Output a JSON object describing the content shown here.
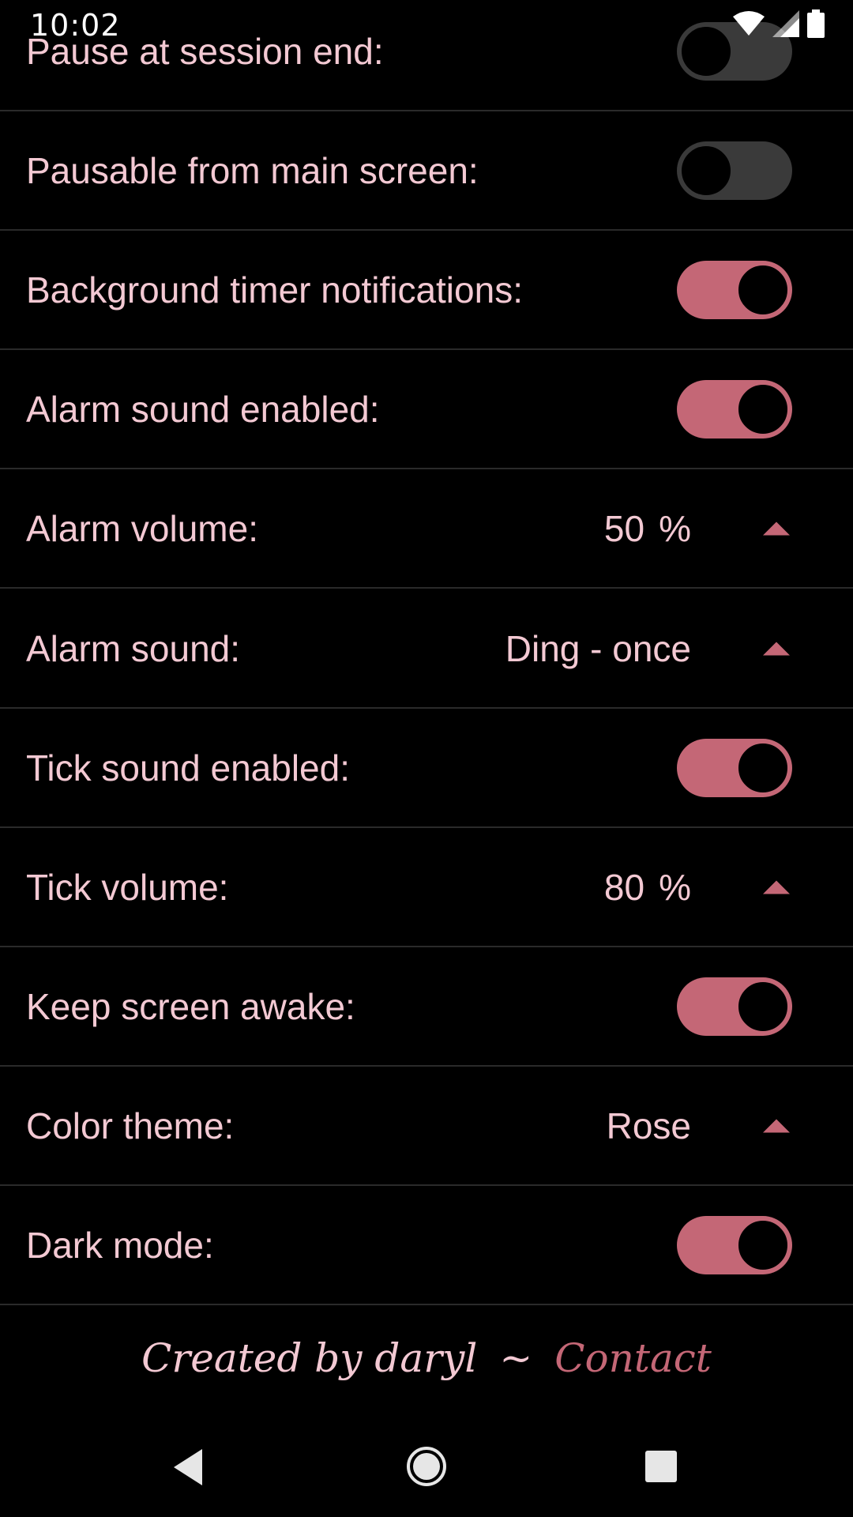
{
  "status_bar": {
    "time": "10:02",
    "icons": [
      "wifi-icon",
      "signal-icon",
      "battery-icon"
    ]
  },
  "settings": [
    {
      "label": "Pause at session end:",
      "type": "toggle",
      "on": false
    },
    {
      "label": "Pausable from main screen:",
      "type": "toggle",
      "on": false
    },
    {
      "label": "Background timer notifications:",
      "type": "toggle",
      "on": true
    },
    {
      "label": "Alarm sound enabled:",
      "type": "toggle",
      "on": true
    },
    {
      "label": "Alarm volume:",
      "type": "select",
      "value": "50",
      "unit": "%"
    },
    {
      "label": "Alarm sound:",
      "type": "select",
      "value": "Ding - once",
      "unit": ""
    },
    {
      "label": "Tick sound enabled:",
      "type": "toggle",
      "on": true
    },
    {
      "label": "Tick volume:",
      "type": "select",
      "value": "80",
      "unit": "%"
    },
    {
      "label": "Keep screen awake:",
      "type": "toggle",
      "on": true
    },
    {
      "label": "Color theme:",
      "type": "select",
      "value": "Rose",
      "unit": ""
    },
    {
      "label": "Dark mode:",
      "type": "toggle",
      "on": true
    }
  ],
  "footer": {
    "created_by": "Created by daryl",
    "separator": "~",
    "contact_label": "Contact"
  },
  "colors": {
    "accent": "#c46776",
    "text": "#f3c9d3",
    "background": "#000000",
    "toggle_off": "#3a3a3a"
  }
}
